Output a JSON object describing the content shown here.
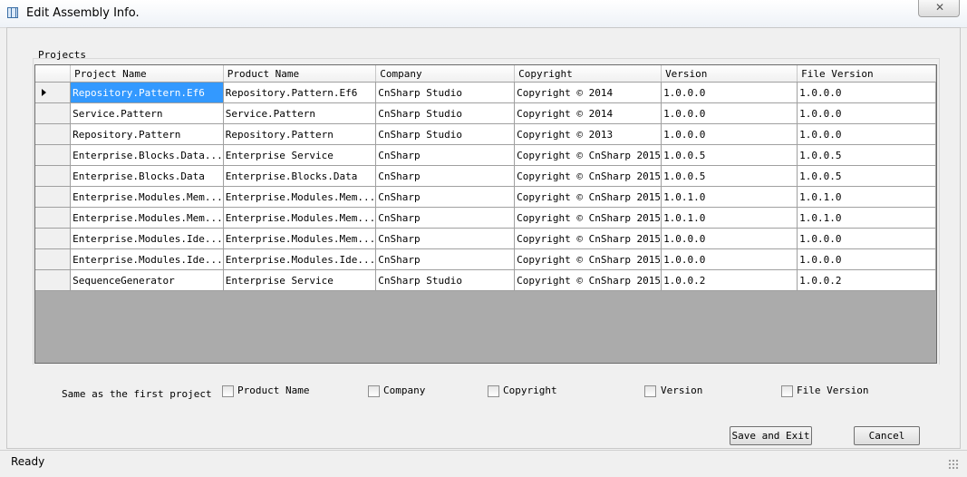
{
  "window": {
    "title": "Edit Assembly Info.",
    "close_glyph": "✕",
    "icon": "assembly-app-icon"
  },
  "group": {
    "label": "Projects"
  },
  "grid": {
    "columns": [
      "Project Name",
      "Product Name",
      "Company",
      "Copyright",
      "Version",
      "File Version"
    ],
    "selected_row": 0,
    "selected_col": 0,
    "current_row_marker": "row-arrow-icon",
    "rows": [
      [
        "Repository.Pattern.Ef6",
        "Repository.Pattern.Ef6",
        "CnSharp Studio",
        "Copyright ©  2014",
        "1.0.0.0",
        "1.0.0.0"
      ],
      [
        "Service.Pattern",
        "Service.Pattern",
        "CnSharp Studio",
        "Copyright ©  2014",
        "1.0.0.0",
        "1.0.0.0"
      ],
      [
        "Repository.Pattern",
        "Repository.Pattern",
        "CnSharp Studio",
        "Copyright ©  2013",
        "1.0.0.0",
        "1.0.0.0"
      ],
      [
        "Enterprise.Blocks.Data...",
        "Enterprise Service",
        "CnSharp",
        "Copyright © CnSharp 2015",
        "1.0.0.5",
        "1.0.0.5"
      ],
      [
        "Enterprise.Blocks.Data",
        "Enterprise.Blocks.Data",
        "CnSharp",
        "Copyright © CnSharp 2015",
        "1.0.0.5",
        "1.0.0.5"
      ],
      [
        "Enterprise.Modules.Mem...",
        "Enterprise.Modules.Mem...",
        "CnSharp",
        "Copyright © CnSharp 2015",
        "1.0.1.0",
        "1.0.1.0"
      ],
      [
        "Enterprise.Modules.Mem...",
        "Enterprise.Modules.Mem...",
        "CnSharp",
        "Copyright © CnSharp 2015",
        "1.0.1.0",
        "1.0.1.0"
      ],
      [
        "Enterprise.Modules.Ide...",
        "Enterprise.Modules.Mem...",
        "CnSharp",
        "Copyright © CnSharp 2015",
        "1.0.0.0",
        "1.0.0.0"
      ],
      [
        "Enterprise.Modules.Ide...",
        "Enterprise.Modules.Ide...",
        "CnSharp",
        "Copyright © CnSharp 2015",
        "1.0.0.0",
        "1.0.0.0"
      ],
      [
        "SequenceGenerator",
        "Enterprise Service",
        "CnSharp Studio",
        "Copyright © CnSharp 2015",
        "1.0.0.2",
        "1.0.0.2"
      ]
    ]
  },
  "same_as_first": {
    "label": "Same as the first project",
    "options": [
      {
        "label": "Product Name",
        "checked": false
      },
      {
        "label": "Company",
        "checked": false
      },
      {
        "label": "Copyright",
        "checked": false
      },
      {
        "label": "Version",
        "checked": false
      },
      {
        "label": "File Version",
        "checked": false
      }
    ]
  },
  "buttons": {
    "save": "Save and Exit",
    "cancel": "Cancel"
  },
  "status": {
    "text": "Ready"
  }
}
